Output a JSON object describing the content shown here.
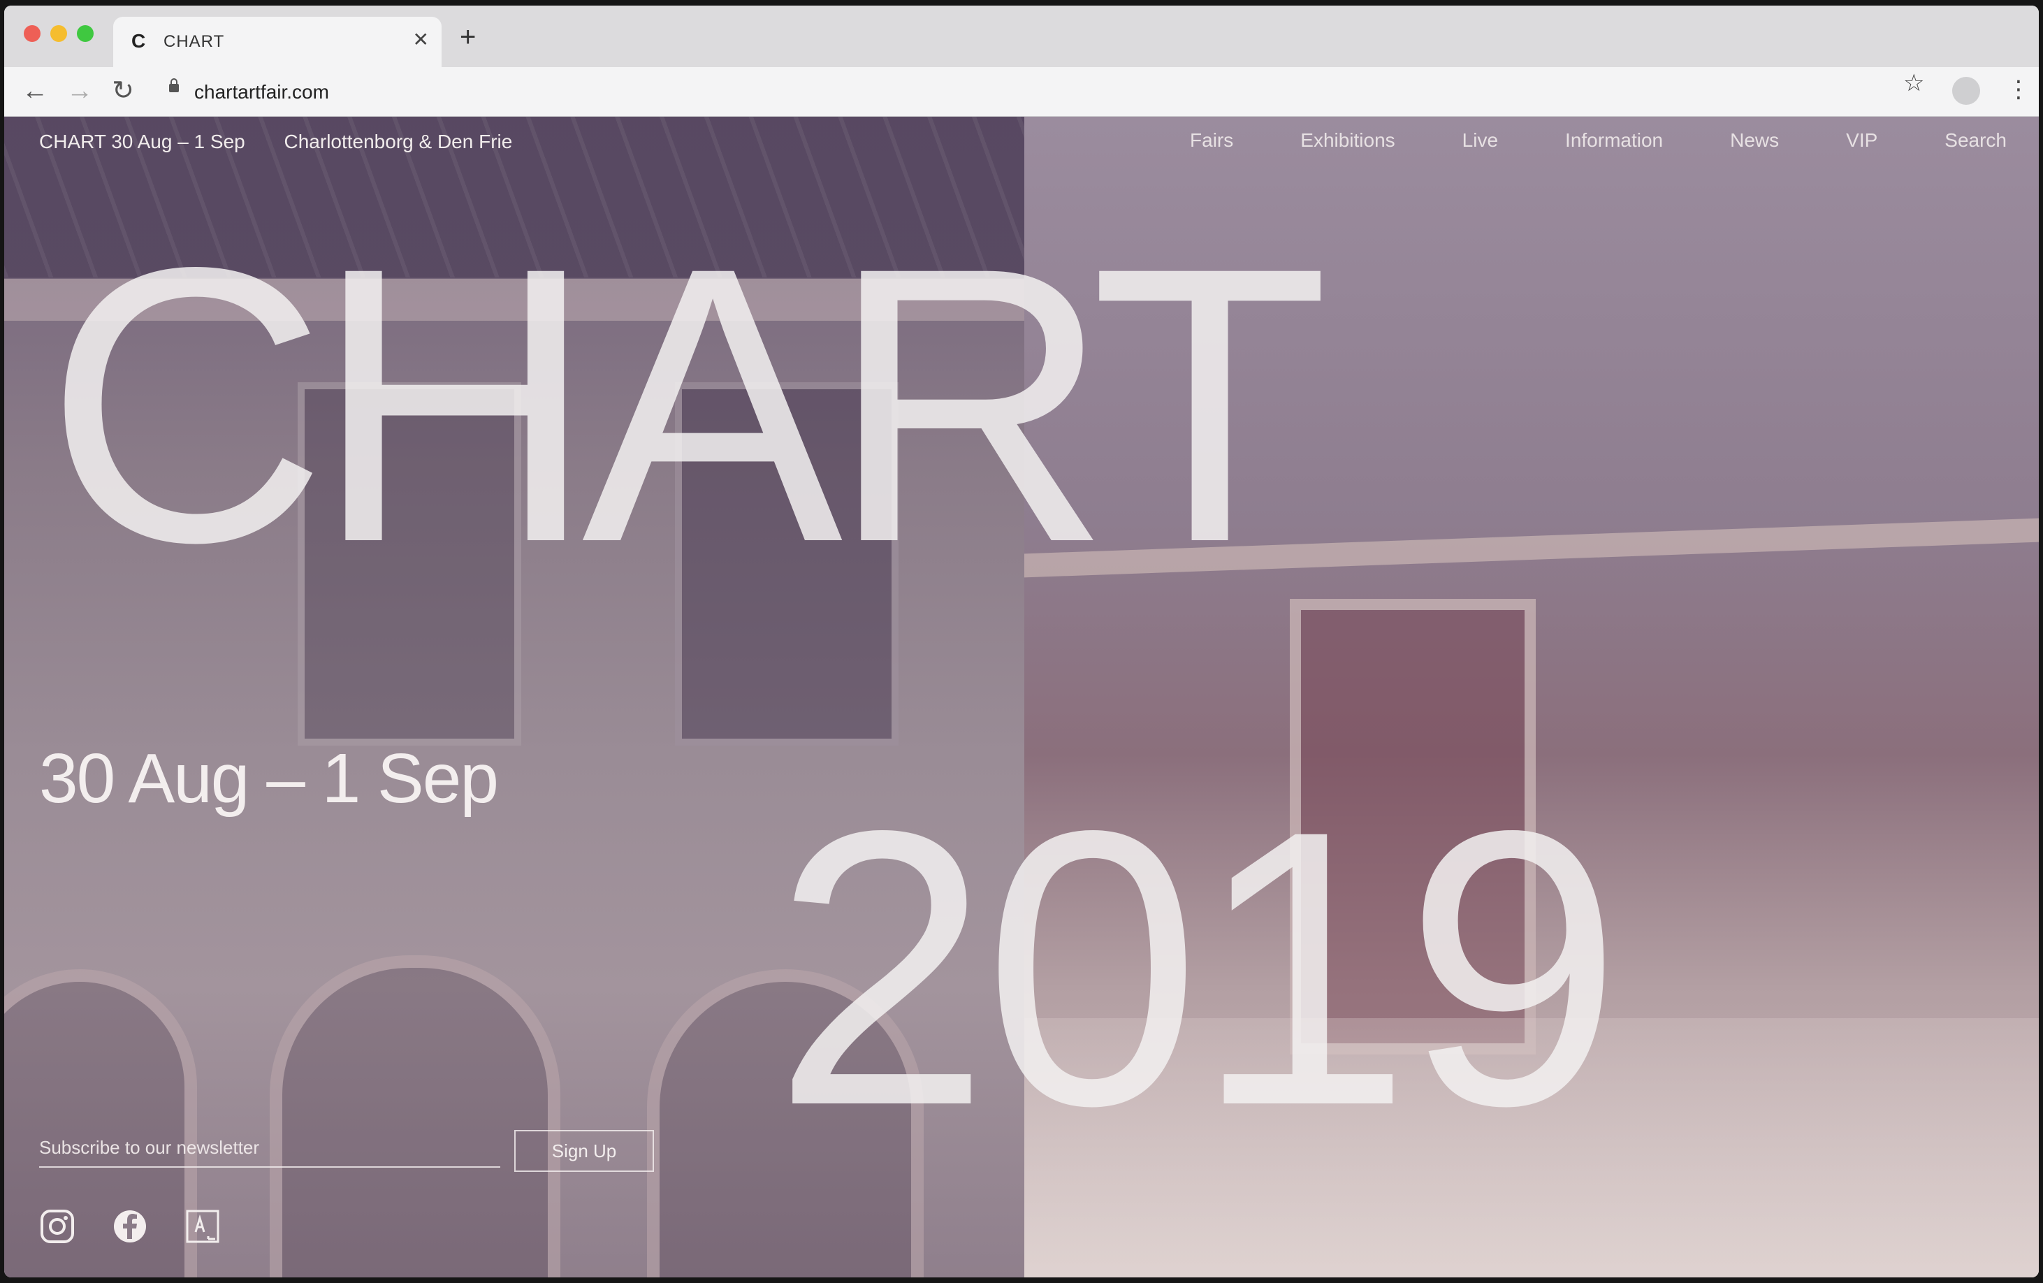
{
  "browser": {
    "tab_title": "CHART",
    "tab_favicon": "C",
    "url": "chartartfair.com"
  },
  "site": {
    "nav_left": [
      "CHART 30 Aug – 1 Sep",
      "Charlottenborg & Den Frie"
    ],
    "nav_right": [
      "Fairs",
      "Exhibitions",
      "Live",
      "Information",
      "News",
      "VIP",
      "Search"
    ],
    "hero_title": "CHART",
    "hero_year": "2019",
    "dates": "30 Aug – 1 Sep",
    "newsletter_placeholder": "Subscribe to our newsletter",
    "signup_label": "Sign Up",
    "social": [
      "instagram-icon",
      "facebook-icon",
      "artsy-icon"
    ]
  },
  "colors": {
    "overlay_text": "#f2f0f0",
    "traffic_red": "#ee5f56",
    "traffic_yellow": "#f5bd2f",
    "traffic_green": "#3fc840"
  }
}
